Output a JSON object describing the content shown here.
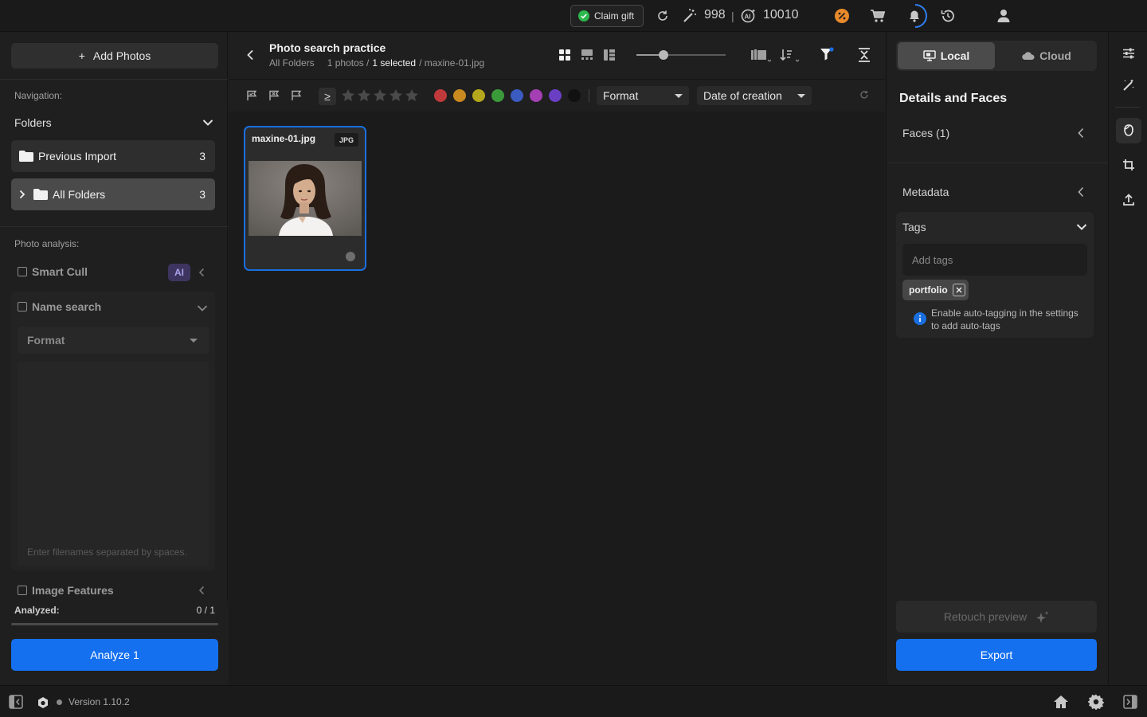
{
  "topbar": {
    "claim_gift": "Claim gift",
    "credits": "998",
    "separator": "|",
    "ai_credits": "10010"
  },
  "left": {
    "add_photos": "Add Photos",
    "add_icon": "+",
    "navigation_label": "Navigation:",
    "folders_label": "Folders",
    "folders": [
      {
        "name": "Previous Import",
        "count": "3"
      },
      {
        "name": "All Folders",
        "count": "3"
      }
    ],
    "photo_analysis_label": "Photo analysis:",
    "smart_cull": "Smart Cull",
    "ai_badge": "AI",
    "name_search": "Name search",
    "format_select": "Format",
    "filenames_placeholder": "Enter filenames separated by spaces.",
    "image_features": "Image Features",
    "analyzed_label": "Analyzed:",
    "analyzed_value": "0 / 1",
    "analyzed_progress": 0,
    "analyze_button": "Analyze 1"
  },
  "middle": {
    "title": "Photo search practice",
    "breadcrumb_root": "All Folders",
    "photos_count": "1 photos /",
    "selected": "1 selected",
    "filename_suffix": "/ maxine-01.jpg",
    "thumbnail_size_level": 0.3,
    "gte_symbol": "≥",
    "rating_stars": 5,
    "color_labels": [
      "#c0393b",
      "#c98a1f",
      "#b6a81c",
      "#3a9a3a",
      "#3a5bbf",
      "#a43fb4",
      "#6a3fc4",
      "#111111"
    ],
    "format_dropdown": "Format",
    "date_dropdown": "Date of creation",
    "thumbnail": {
      "filename": "maxine-01.jpg",
      "type_badge": "JPG"
    }
  },
  "right": {
    "local_tab": "Local",
    "cloud_tab": "Cloud",
    "section_title": "Details and Faces",
    "faces": "Faces (1)",
    "metadata": "Metadata",
    "tags_label": "Tags",
    "add_tags_placeholder": "Add tags",
    "tag_chip": "portfolio",
    "info_text_line1": "Enable auto-tagging in the settings",
    "info_text_line2": "to add auto-tags",
    "retouch_preview": "Retouch preview",
    "export": "Export"
  },
  "status": {
    "version": "Version 1.10.2"
  }
}
